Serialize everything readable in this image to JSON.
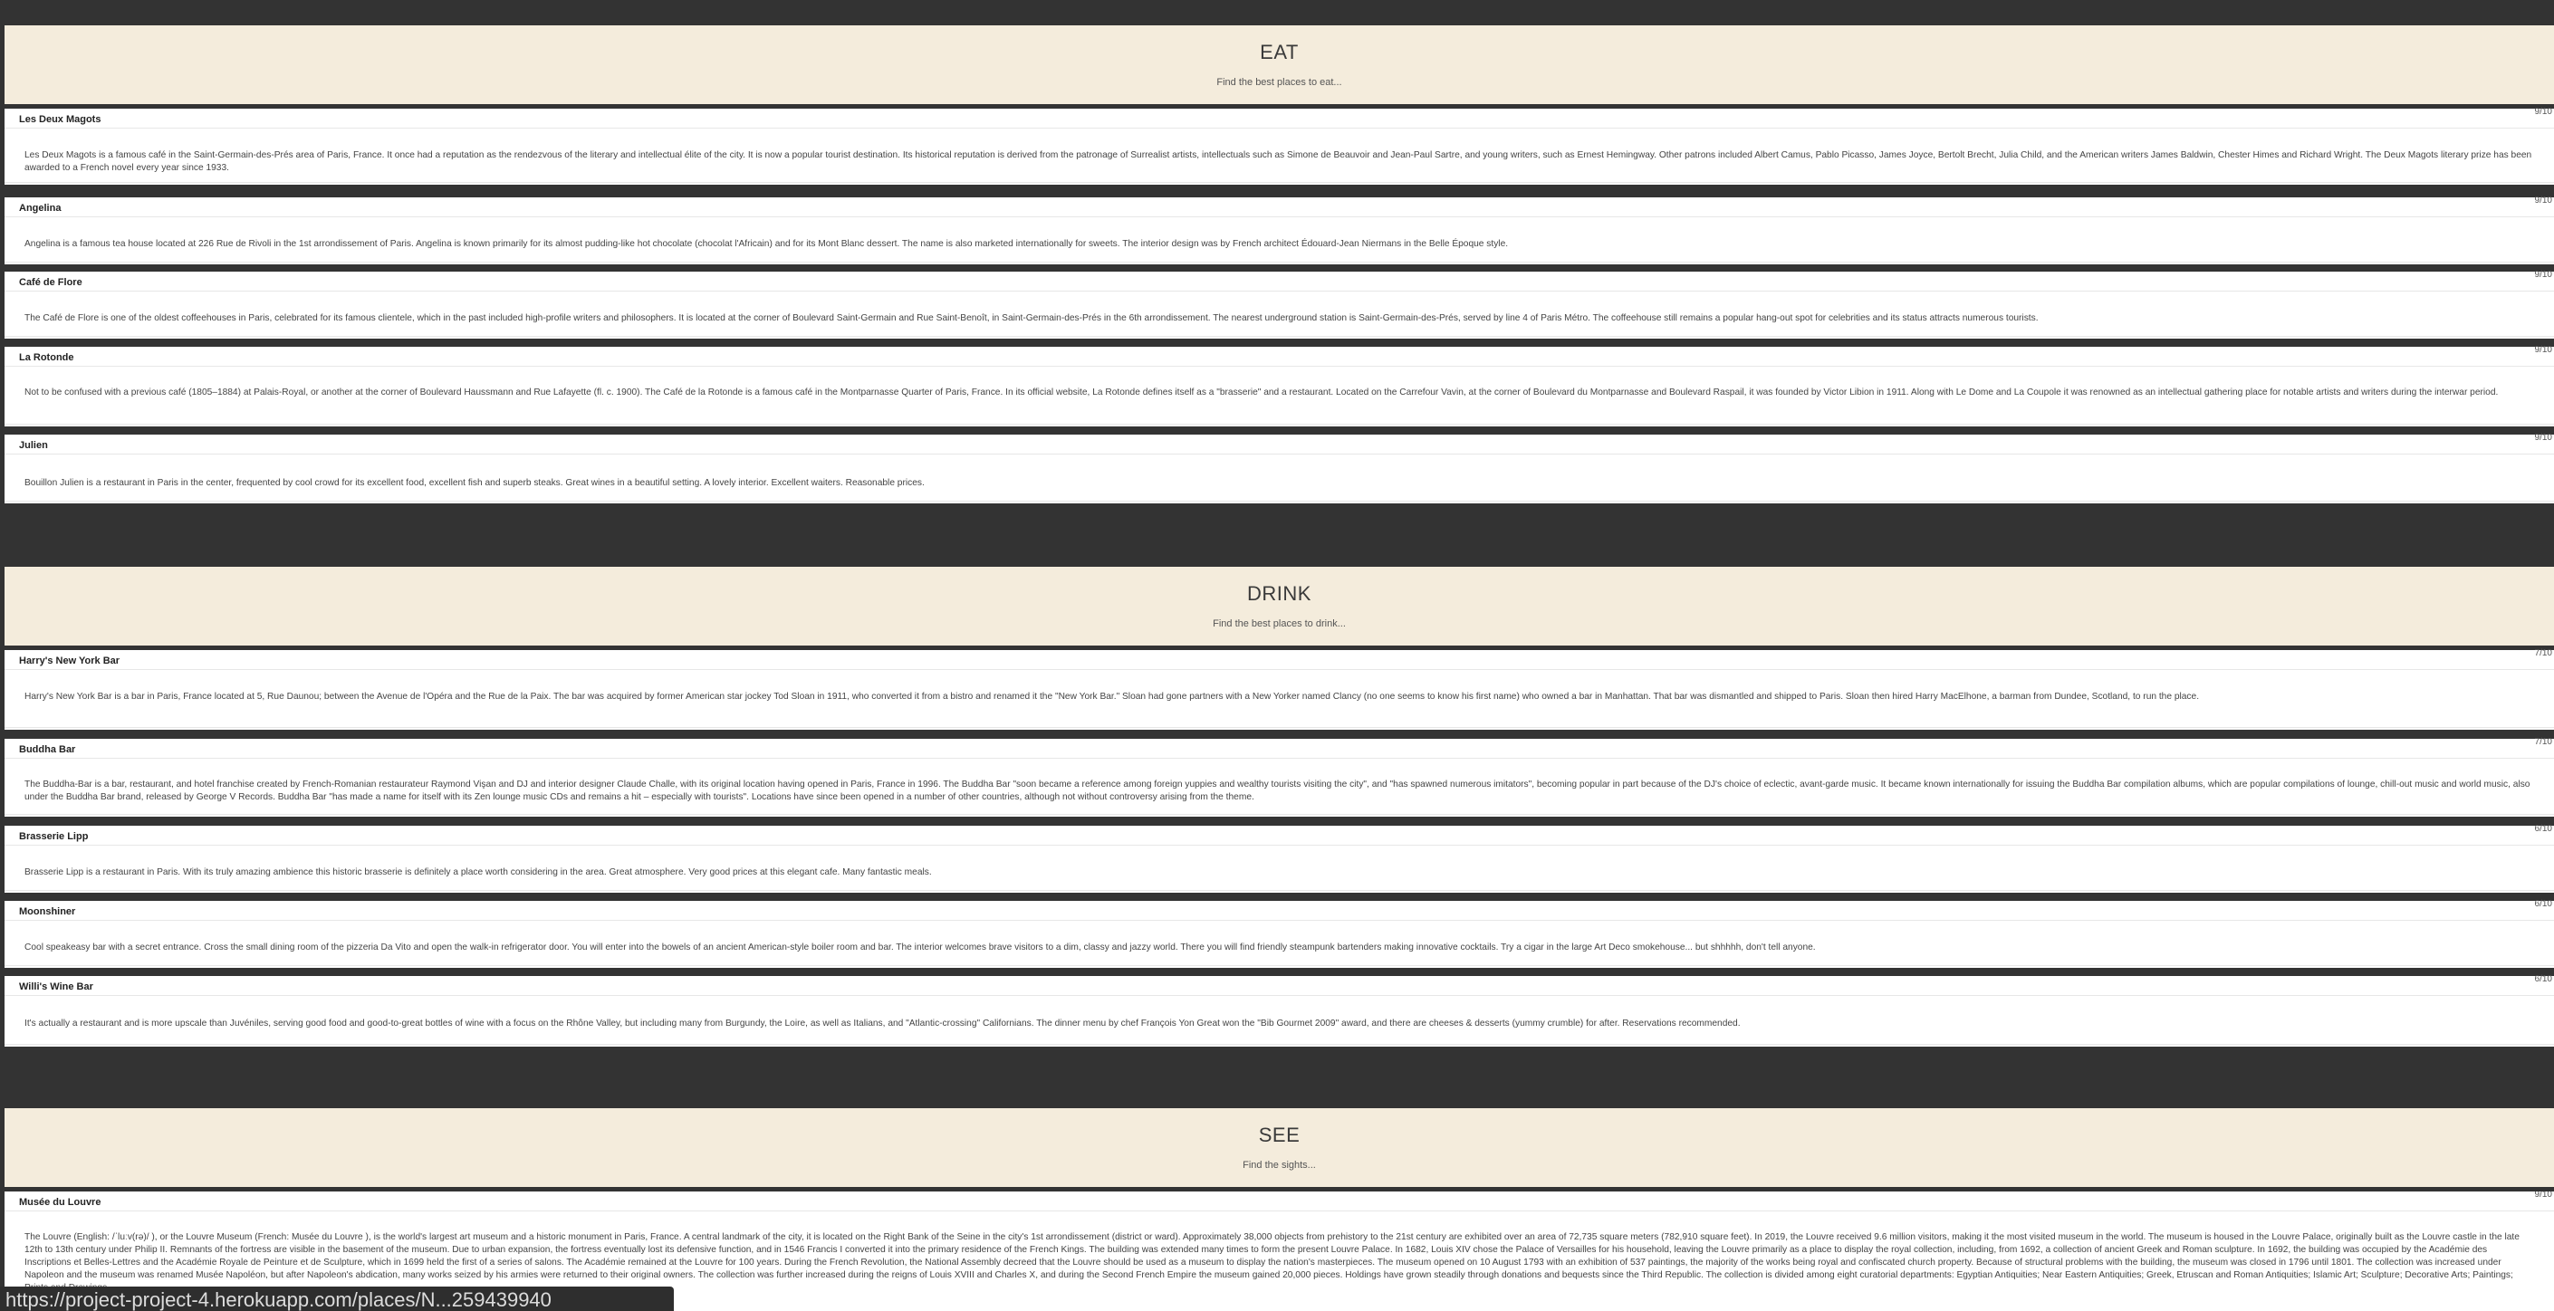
{
  "sections": [
    {
      "title": "EAT",
      "subtitle": "Find the best places to eat...",
      "places": [
        {
          "name": "Les Deux Magots",
          "score": "9/10",
          "description": "Les Deux Magots is a famous café in the Saint-Germain-des-Prés area of Paris, France. It once had a reputation as the rendezvous of the literary and intellectual élite of the city. It is now a popular tourist destination. Its historical reputation is derived from the patronage of Surrealist artists, intellectuals such as Simone de Beauvoir and Jean-Paul Sartre, and young writers, such as Ernest Hemingway. Other patrons included Albert Camus, Pablo Picasso, James Joyce, Bertolt Brecht, Julia Child, and the American writers James Baldwin, Chester Himes and Richard Wright. The Deux Magots literary prize has been awarded to a French novel every year since 1933."
        },
        {
          "name": "Angelina",
          "score": "9/10",
          "description": "Angelina is a famous tea house located at 226 Rue de Rivoli in the 1st arrondissement of Paris. Angelina is known primarily for its almost pudding-like hot chocolate (chocolat l'Africain) and for its Mont Blanc dessert. The name is also marketed internationally for sweets. The interior design was by French architect Édouard-Jean Niermans in the Belle Époque style."
        },
        {
          "name": "Café de Flore",
          "score": "9/10",
          "description": "The Café de Flore is one of the oldest coffeehouses in Paris, celebrated for its famous clientele, which in the past included high-profile writers and philosophers. It is located at the corner of Boulevard Saint-Germain and Rue Saint-Benoît, in Saint-Germain-des-Prés in the 6th arrondissement. The nearest underground station is Saint-Germain-des-Prés, served by line 4 of Paris Métro. The coffeehouse still remains a popular hang-out spot for celebrities and its status attracts numerous tourists."
        },
        {
          "name": "La Rotonde",
          "score": "9/10",
          "description": "Not to be confused with a previous café (1805–1884) at Palais-Royal, or another at the corner of Boulevard Haussmann and Rue Lafayette (fl. c. 1900). The Café de la Rotonde is a famous café in the Montparnasse Quarter of Paris, France. In its official website, La Rotonde defines itself as a \"brasserie\" and a restaurant. Located on the Carrefour Vavin, at the corner of Boulevard du Montparnasse and Boulevard Raspail, it was founded by Victor Libion in 1911. Along with Le Dome and La Coupole it was renowned as an intellectual gathering place for notable artists and writers during the interwar period."
        },
        {
          "name": "Julien",
          "score": "9/10",
          "description": "Bouillon Julien is a restaurant in Paris in the center, frequented by cool crowd for its excellent food, excellent fish and superb steaks. Great wines in a beautiful setting. A lovely interior. Excellent waiters. Reasonable prices."
        }
      ]
    },
    {
      "title": "DRINK",
      "subtitle": "Find the best places to drink...",
      "places": [
        {
          "name": "Harry's New York Bar",
          "score": "7/10",
          "description": "Harry's New York Bar is a bar in Paris, France located at 5, Rue Daunou; between the Avenue de l'Opéra and the Rue de la Paix. The bar was acquired by former American star jockey Tod Sloan in 1911, who converted it from a bistro and renamed it the \"New York Bar.\" Sloan had gone partners with a New Yorker named Clancy (no one seems to know his first name) who owned a bar in Manhattan. That bar was dismantled and shipped to Paris. Sloan then hired Harry MacElhone, a barman from Dundee, Scotland, to run the place."
        },
        {
          "name": "Buddha Bar",
          "score": "7/10",
          "description": "The Buddha-Bar is a bar, restaurant, and hotel franchise created by French-Romanian restaurateur Raymond Vişan and DJ and interior designer Claude Challe, with its original location having opened in Paris, France in 1996. The Buddha Bar \"soon became a reference among foreign yuppies and wealthy tourists visiting the city\", and \"has spawned numerous imitators\", becoming popular in part because of the DJ's choice of eclectic, avant-garde music. It became known internationally for issuing the Buddha Bar compilation albums, which are popular compilations of lounge, chill-out music and world music, also under the Buddha Bar brand, released by George V Records. Buddha Bar \"has made a name for itself with its Zen lounge music CDs and remains a hit – especially with tourists\". Locations have since been opened in a number of other countries, although not without controversy arising from the theme."
        },
        {
          "name": "Brasserie Lipp",
          "score": "6/10",
          "description": "Brasserie Lipp is a restaurant in Paris. With its truly amazing ambience this historic brasserie is definitely a place worth considering in the area. Great atmosphere. Very good prices at this elegant cafe. Many fantastic meals."
        },
        {
          "name": "Moonshiner",
          "score": "6/10",
          "description": "Cool speakeasy bar with a secret entrance. Cross the small dining room of the pizzeria Da Vito and open the walk-in refrigerator door. You will enter into the bowels of an ancient American-style boiler room and bar. The interior welcomes brave visitors to a dim, classy and jazzy world. There you will find friendly steampunk bartenders making innovative cocktails. Try a cigar in the large Art Deco smokehouse... but shhhhh, don't tell anyone."
        },
        {
          "name": "Willi's Wine Bar",
          "score": "6/10",
          "description": "It's actually a restaurant and is more upscale than Juvéniles, serving good food and good-to-great bottles of wine with a focus on the Rhône Valley, but including many from Burgundy, the Loire, as well as Italians, and \"Atlantic-crossing\" Californians. The dinner menu by chef François Yon Great won the \"Bib Gourmet 2009\" award, and there are cheeses & desserts (yummy crumble) for after. Reservations recommended."
        }
      ]
    },
    {
      "title": "SEE",
      "subtitle": "Find the sights...",
      "places": [
        {
          "name": "Musée du Louvre",
          "score": "9/10",
          "description": "The Louvre (English: /ˈluːv(rə)/ ), or the Louvre Museum (French: Musée du Louvre ), is the world's largest art museum and a historic monument in Paris, France. A central landmark of the city, it is located on the Right Bank of the Seine in the city's 1st arrondissement (district or ward). Approximately 38,000 objects from prehistory to the 21st century are exhibited over an area of 72,735 square meters (782,910 square feet). In 2019, the Louvre received 9.6 million visitors, making it the most visited museum in the world. The museum is housed in the Louvre Palace, originally built as the Louvre castle in the late 12th to 13th century under Philip II. Remnants of the fortress are visible in the basement of the museum. Due to urban expansion, the fortress eventually lost its defensive function, and in 1546 Francis I converted it into the primary residence of the French Kings. The building was extended many times to form the present Louvre Palace. In 1682, Louis XIV chose the Palace of Versailles for his household, leaving the Louvre primarily as a place to display the royal collection, including, from 1692, a collection of ancient Greek and Roman sculpture. In 1692, the building was occupied by the Académie des Inscriptions et Belles-Lettres and the Académie Royale de Peinture et de Sculpture, which in 1699 held the first of a series of salons. The Académie remained at the Louvre for 100 years. During the French Revolution, the National Assembly decreed that the Louvre should be used as a museum to display the nation's masterpieces. The museum opened on 10 August 1793 with an exhibition of 537 paintings, the majority of the works being royal and confiscated church property. Because of structural problems with the building, the museum was closed in 1796 until 1801. The collection was increased under Napoleon and the museum was renamed Musée Napoléon, but after Napoleon's abdication, many works seized by his armies were returned to their original owners. The collection was further increased during the reigns of Louis XVIII and Charles X, and during the Second French Empire the museum gained 20,000 pieces. Holdings have grown steadily through donations and bequests since the Third Republic. The collection is divided among eight curatorial departments: Egyptian Antiquities; Near Eastern Antiquities; Greek, Etruscan and Roman Antiquities; Islamic Art; Sculpture; Decorative Arts; Paintings; Prints and Drawings."
        }
      ]
    }
  ],
  "status_bar": {
    "url": "https://project-project-4.herokuapp.com/places/N...259439940"
  }
}
